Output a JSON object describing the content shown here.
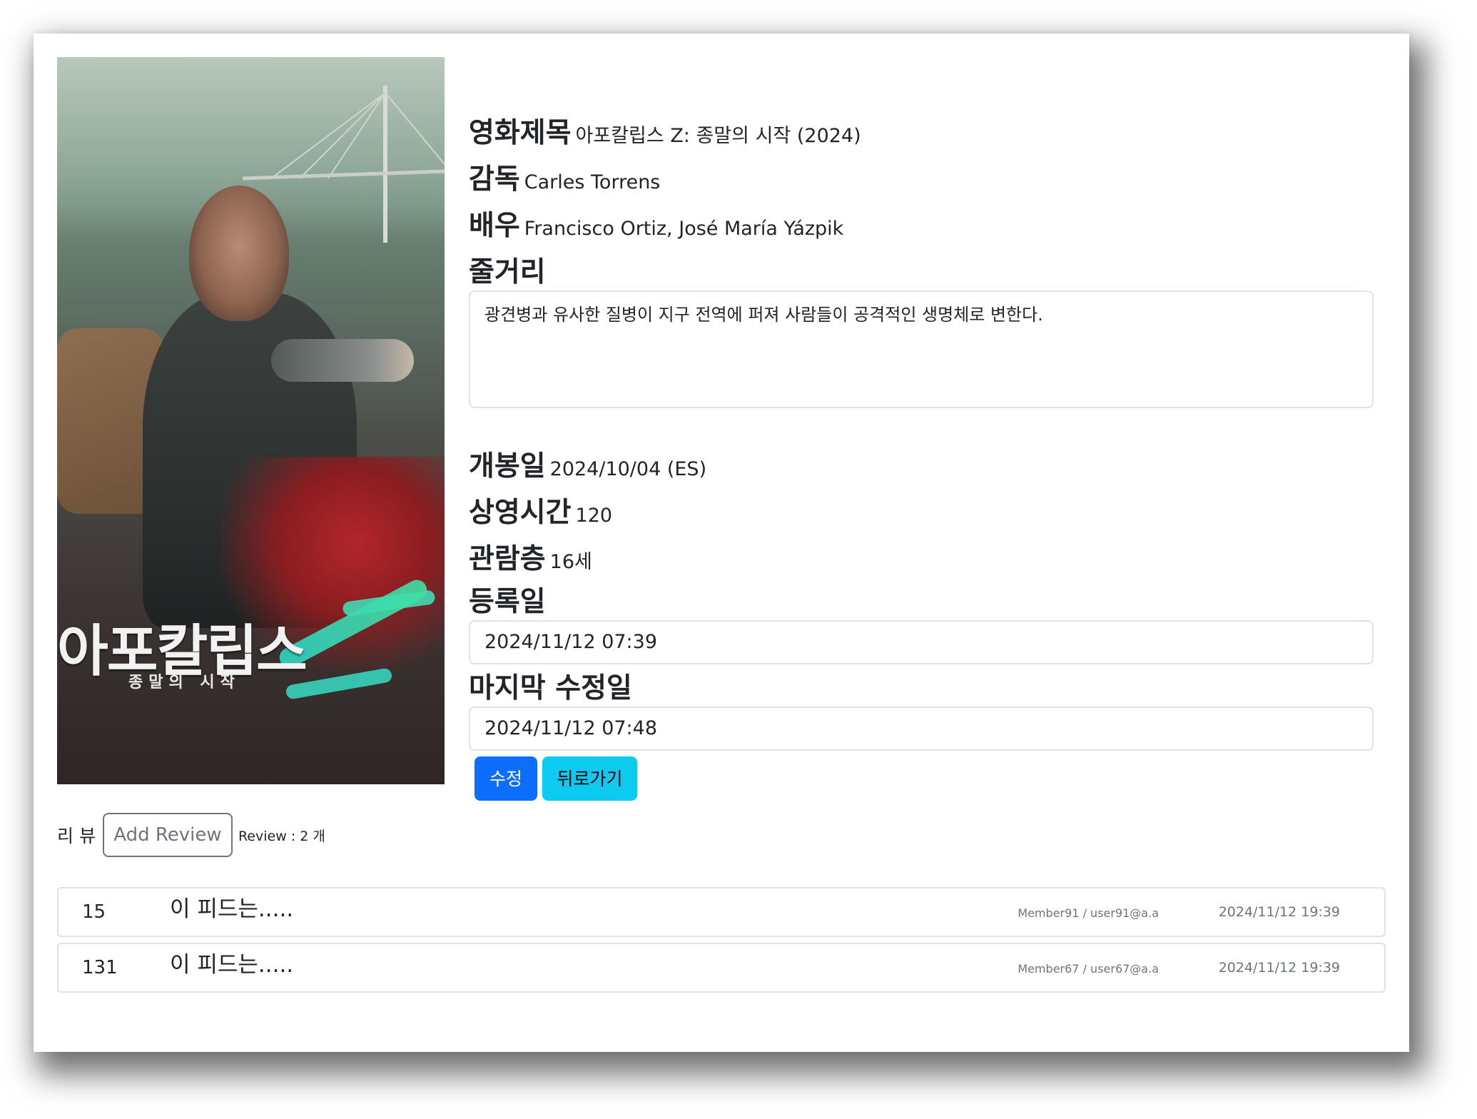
{
  "movie": {
    "title_label": "영화제목",
    "title_value": "아포칼립스 Z: 종말의 시작 (2024)",
    "director_label": "감독",
    "director_value": "Carles Torrens",
    "cast_label": "배우",
    "cast_value": "Francisco Ortiz, José María Yázpik",
    "plot_label": "줄거리",
    "plot_value": "광견병과 유사한 질병이 지구 전역에 퍼져 사람들이 공격적인 생명체로 변한다.",
    "release_label": "개봉일",
    "release_value": "2024/10/04 (ES)",
    "runtime_label": "상영시간",
    "runtime_value": "120",
    "rating_label": "관람층",
    "rating_value": "16세",
    "registered_label": "등록일",
    "registered_value": "2024/11/12 07:39",
    "modified_label": "마지막 수정일",
    "modified_value": "2024/11/12 07:48"
  },
  "poster": {
    "title_art": "아포칼립스",
    "subtitle_art": "종말의 시작",
    "logo_letter": "Z"
  },
  "actions": {
    "edit_label": "수정",
    "back_label": "뒤로가기"
  },
  "reviews": {
    "section_label": "리 뷰",
    "add_label": "Add Review",
    "count_text": "Review : 2 개",
    "items": [
      {
        "no": "15",
        "text": "이 피드는.....",
        "member": "Member91 / user91@a.a",
        "date": "2024/11/12 19:39"
      },
      {
        "no": "131",
        "text": "이 피드는.....",
        "member": "Member67 / user67@a.a",
        "date": "2024/11/12 19:39"
      }
    ]
  },
  "colors": {
    "primary": "#0d6efd",
    "info": "#0dcaf0",
    "secondary": "#6c757d",
    "border": "#dee2e6"
  }
}
